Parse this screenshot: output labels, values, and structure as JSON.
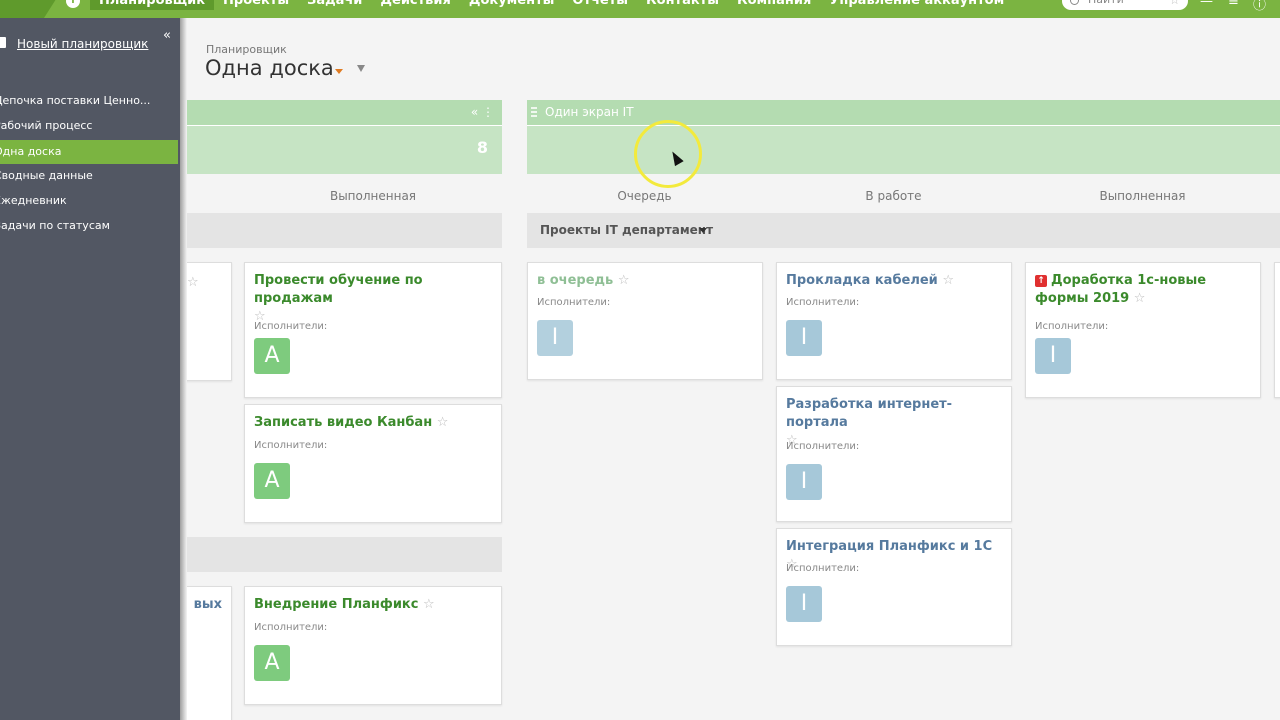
{
  "topbar": {
    "nav": [
      "Планировщик",
      "Проекты",
      "Задачи",
      "Действия",
      "Документы",
      "Отчеты",
      "Контакты",
      "Компания",
      "Управление аккаунтом"
    ],
    "active_index": 0,
    "search_placeholder": "Найти",
    "brand_color": "#7bb441"
  },
  "sidebar": {
    "title": "Новый планировщик",
    "items": [
      {
        "label": "Цепочка поставки Ценно..."
      },
      {
        "label": "Рабочий процесс"
      },
      {
        "label": "Одна доска",
        "active": true
      },
      {
        "label": "Сводные данные"
      },
      {
        "label": "Ежедневник"
      },
      {
        "label": "Задачи по статусам"
      }
    ]
  },
  "page": {
    "breadcrumb": "Планировщик",
    "title": "Одна доска"
  },
  "board": {
    "left_group": {
      "count": "8"
    },
    "right_group": {
      "title": "Один экран IT"
    },
    "columns": [
      "Выполненная",
      "Очередь",
      "В работе",
      "Выполненная"
    ],
    "swimlane_title": "Проекты IT департамент",
    "left_cards": {
      "partial_title": "вых",
      "c1": {
        "title": "Провести обучение по продажам",
        "label": "Исполнители:",
        "avatar": "А"
      },
      "c2": {
        "title": "Записать видео Канбан",
        "label": "Исполнители:",
        "avatar": "А"
      },
      "c3": {
        "title": "Внедрение Планфикс",
        "label": "Исполнители:",
        "avatar": "А"
      }
    },
    "queue": [
      {
        "title": "в очередь",
        "label": "Исполнители:",
        "avatar": "I"
      }
    ],
    "in_work": [
      {
        "title": "Прокладка кабелей",
        "label": "Исполнители:",
        "avatar": "I"
      },
      {
        "title": "Разработка интернет-портала",
        "label": "Исполнители:",
        "avatar": "I"
      },
      {
        "title": "Интеграция Планфикс и 1С",
        "label": "Исполнители:",
        "avatar": "I"
      }
    ],
    "done": [
      {
        "title": "Доработка 1с-новые формы 2019",
        "label": "Исполнители:",
        "avatar": "I",
        "priority_icon": "↑"
      }
    ]
  }
}
